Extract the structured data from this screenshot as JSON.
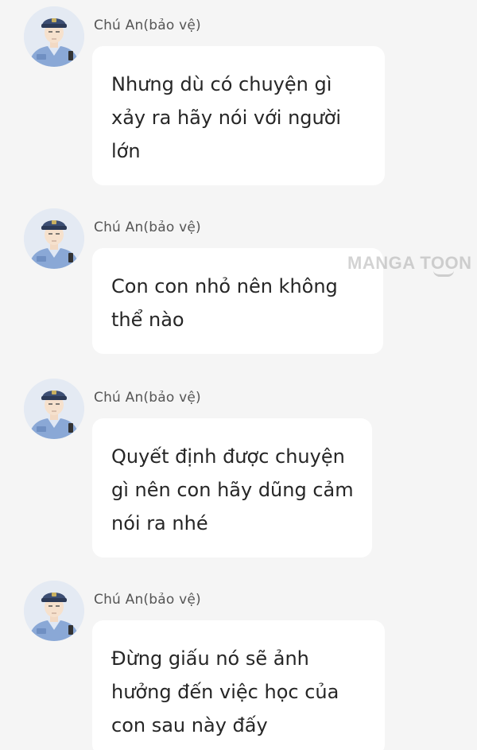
{
  "watermark": "MANGA TOON",
  "messages": [
    {
      "sender": "Chú An(bảo vệ)",
      "text": "Nhưng dù có chuyện gì xảy ra hãy nói với người lớn"
    },
    {
      "sender": "Chú An(bảo vệ)",
      "text": "Con con nhỏ nên không thể nào"
    },
    {
      "sender": "Chú An(bảo vệ)",
      "text": "Quyết định được chuyện gì nên con hãy dũng cảm nói ra nhé"
    },
    {
      "sender": "Chú An(bảo vệ)",
      "text": "Đừng giấu nó sẽ ảnh hưởng đến việc học của con sau này đấy"
    }
  ],
  "colors": {
    "background": "#f5f5f5",
    "bubble": "#ffffff",
    "uniform": "#7d9dcc"
  }
}
